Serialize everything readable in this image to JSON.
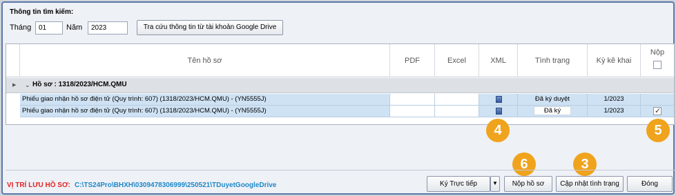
{
  "search": {
    "title": "Thông tin tìm kiếm:",
    "month_label": "Tháng",
    "month_value": "01",
    "year_label": "Năm",
    "year_value": "2023",
    "gdrive_button": "Tra cứu thông tin từ tài khoản Google Drive"
  },
  "grid": {
    "columns": {
      "name": "Tên hồ sơ",
      "pdf": "PDF",
      "excel": "Excel",
      "xml": "XML",
      "status": "Tình trạng",
      "period": "Kỳ kê khai",
      "submit": "Nộp"
    },
    "group_label": "Hồ sơ : 1318/2023/HCM.QMU",
    "rows": [
      {
        "name": "Phiếu giao nhận hồ sơ điện tử (Quy trình: 607) (1318/2023/HCM.QMU) - (YN5555J)",
        "status": "Đã ký duyệt",
        "period": "1/2023",
        "submit_checked": false
      },
      {
        "name": "Phiếu giao nhận hồ sơ điện tử (Quy trình: 607) (1318/2023/HCM.QMU) - (YN5555J)",
        "status": "Đã ký",
        "period": "1/2023",
        "submit_checked": true
      }
    ]
  },
  "markers": {
    "m4": "4",
    "m5": "5",
    "m6": "6",
    "m3": "3"
  },
  "footer": {
    "location_label": "VỊ TRÍ LƯU HỒ SƠ:",
    "location_path": "C:\\TS24Pro\\BHXH\\0309478306999\\250521\\TDuyetGoogleDrive",
    "sign_button": "Ký Trực tiếp",
    "submit_button": "Nộp hồ sơ",
    "update_button": "Cập nhật tình trạng",
    "close_button": "Đóng"
  },
  "colors": {
    "marker": "#f0a31c",
    "location_label": "#e32424",
    "location_path": "#1e88c8"
  }
}
